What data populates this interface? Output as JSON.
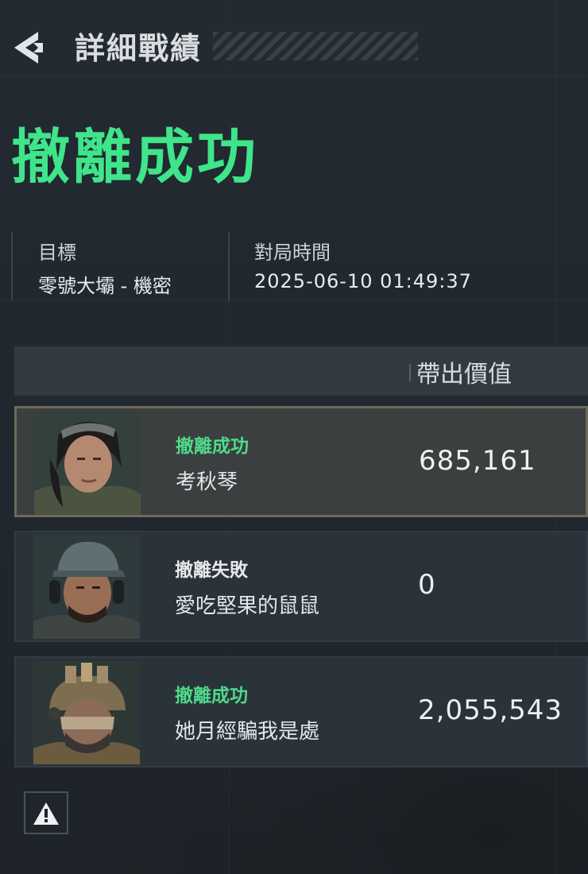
{
  "header": {
    "title": "詳細戰績",
    "back_icon": "back-arrow-icon"
  },
  "result": {
    "title": "撤離成功",
    "color": "#3ee58a"
  },
  "info": {
    "target_label": "目標",
    "target_value": "零號大壩 - 機密",
    "time_label": "對局時間",
    "time_value": "2025-06-10 01:49:37"
  },
  "table": {
    "value_column_label": "帶出價值",
    "rows": [
      {
        "status": "撤離成功",
        "status_type": "success",
        "name": "考秋琴",
        "value": "685,161",
        "avatar": "operator-female-goggles-portrait"
      },
      {
        "status": "撤離失敗",
        "status_type": "failure",
        "name": "愛吃堅果的鼠鼠",
        "value": "0",
        "avatar": "operator-cap-headset-portrait"
      },
      {
        "status": "撤離成功",
        "status_type": "success",
        "name": "她月經騙我是處",
        "value": "2,055,543",
        "avatar": "operator-helmet-mask-portrait"
      }
    ]
  },
  "footer": {
    "report_icon": "warning-icon"
  }
}
